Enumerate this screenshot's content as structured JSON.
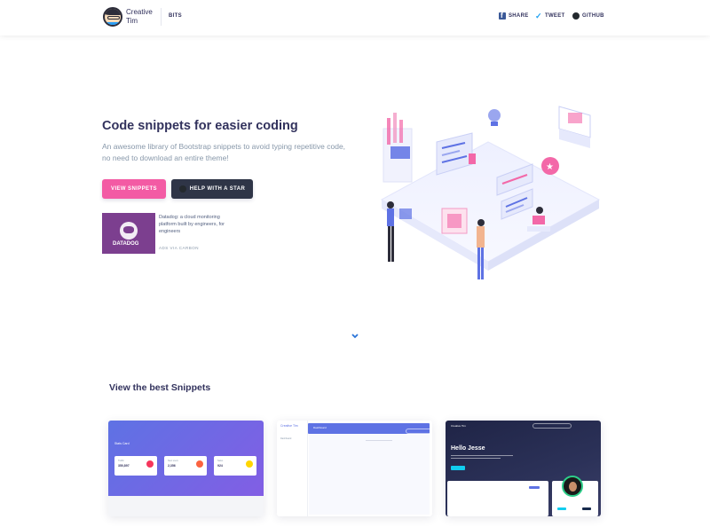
{
  "navbar": {
    "brand_line1": "Creative",
    "brand_line2": "Tim",
    "section": "BITS",
    "links": [
      {
        "label": "SHARE",
        "icon": "facebook-icon"
      },
      {
        "label": "TWEET",
        "icon": "twitter-icon"
      },
      {
        "label": "GITHUB",
        "icon": "github-icon"
      }
    ]
  },
  "hero": {
    "title": "Code snippets for easier coding",
    "description": "An awesome library of Bootstrap snippets to avoid typing repetitive code, no need to download an entire theme!",
    "primary_button": "VIEW SNIPPETS",
    "secondary_button": "HELP WITH A STAR"
  },
  "ad": {
    "image_label": "DATADOG",
    "text": "Datadog: a cloud monitoring platform built by engineers, for engineers",
    "via": "ADS VIA CARBON"
  },
  "colors": {
    "primary": "#f35ba4",
    "dark": "#2f3547",
    "indigo": "#5e72e4",
    "text": "#32325d",
    "muted": "#8898aa"
  },
  "section": {
    "title": "View the best Snippets"
  },
  "cards": {
    "card1": {
      "title": "Stats Card",
      "stats": [
        {
          "label": "Traffic",
          "value": "350,897",
          "color": "#f5365c"
        },
        {
          "label": "New users",
          "value": "2,356",
          "color": "#fb6340"
        },
        {
          "label": "Sales",
          "value": "924",
          "color": "#ffd600"
        }
      ]
    },
    "card2": {
      "brand": "Creative Tim",
      "topbar": "Dashboard",
      "side_item": "Dashboard"
    },
    "card3": {
      "brand": "Creative Tim",
      "greeting": "Hello Jesse"
    }
  }
}
